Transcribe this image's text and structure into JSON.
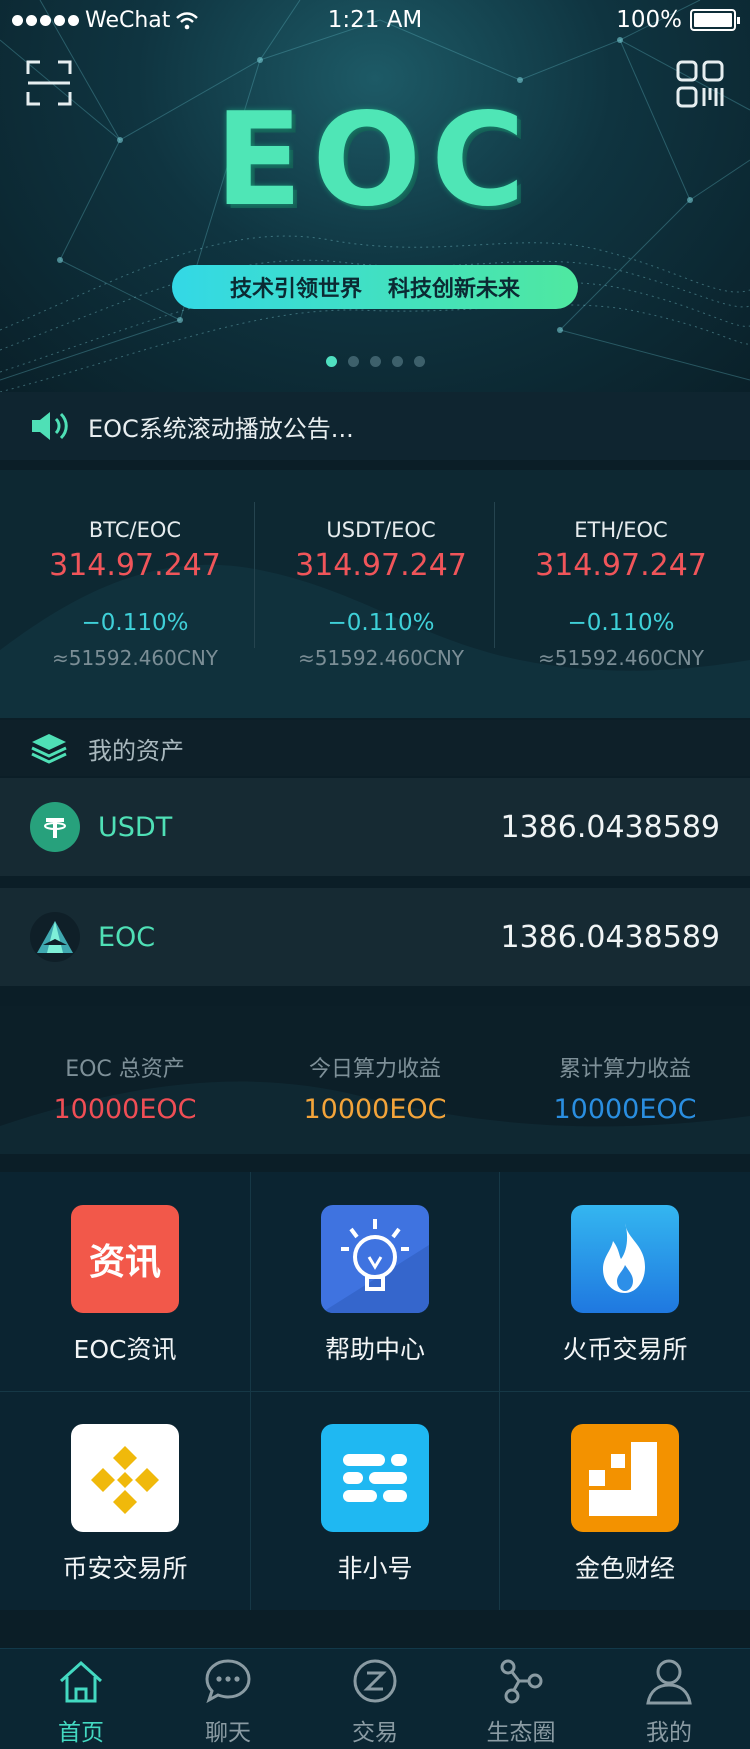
{
  "status_bar": {
    "carrier": "WeChat",
    "time": "1:21 AM",
    "battery": "100%"
  },
  "banner": {
    "logo": "EOC",
    "slogan_left": "技术引领世界",
    "slogan_right": "科技创新未来",
    "slides": 5,
    "active_slide": 0
  },
  "notice": {
    "text": "EOC系统滚动播放公告..."
  },
  "market": [
    {
      "pair": "BTC/EOC",
      "price": "314.97.247",
      "change": "−0.110%",
      "cny": "≈51592.460CNY"
    },
    {
      "pair": "USDT/EOC",
      "price": "314.97.247",
      "change": "−0.110%",
      "cny": "≈51592.460CNY"
    },
    {
      "pair": "ETH/EOC",
      "price": "314.97.247",
      "change": "−0.110%",
      "cny": "≈51592.460CNY"
    }
  ],
  "assets": {
    "title": "我的资产",
    "items": [
      {
        "symbol": "USDT",
        "amount": "1386.0438589"
      },
      {
        "symbol": "EOC",
        "amount": "1386.0438589"
      }
    ]
  },
  "totals": [
    {
      "label": "EOC 总资产",
      "value": "10000EOC",
      "color": "#f04e55"
    },
    {
      "label": "今日算力收益",
      "value": "10000EOC",
      "color": "#f3a43a"
    },
    {
      "label": "累计算力收益",
      "value": "10000EOC",
      "color": "#2a8ee0"
    }
  ],
  "apps": [
    {
      "label": "EOC资讯",
      "icon": "news-icon",
      "icon_text": "资讯"
    },
    {
      "label": "帮助中心",
      "icon": "lightbulb-icon"
    },
    {
      "label": "火币交易所",
      "icon": "flame-icon"
    },
    {
      "label": "币安交易所",
      "icon": "binance-icon"
    },
    {
      "label": "非小号",
      "icon": "feixiaohao-icon"
    },
    {
      "label": "金色财经",
      "icon": "jinse-icon"
    }
  ],
  "tabs": [
    {
      "label": "首页",
      "icon": "home-icon",
      "active": true
    },
    {
      "label": "聊天",
      "icon": "chat-icon"
    },
    {
      "label": "交易",
      "icon": "trade-icon"
    },
    {
      "label": "生态圈",
      "icon": "ecosystem-icon"
    },
    {
      "label": "我的",
      "icon": "profile-icon"
    }
  ],
  "colors": {
    "accent": "#43d9c1",
    "price_red": "#f0555a",
    "change_cyan": "#3fd0d8"
  }
}
